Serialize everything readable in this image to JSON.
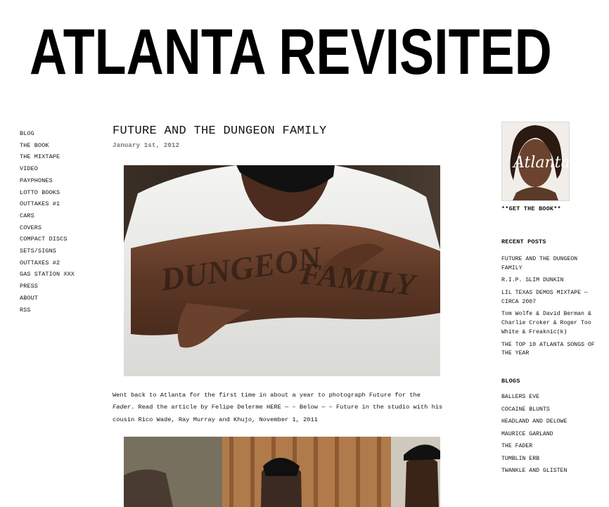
{
  "site": {
    "title": "ATLANTA REVISITED"
  },
  "nav": {
    "items": [
      {
        "label": "BLOG"
      },
      {
        "label": "THE BOOK"
      },
      {
        "label": "THE MIXTAPE"
      },
      {
        "label": "VIDEO"
      },
      {
        "label": "PAYPHONES"
      },
      {
        "label": "LOTTO BOOKS"
      },
      {
        "label": "OUTTAKES #1"
      },
      {
        "label": "CARS"
      },
      {
        "label": "COVERS"
      },
      {
        "label": "COMPACT DISCS"
      },
      {
        "label": "SETS/SIGNS"
      },
      {
        "label": "OUTTAXES #2"
      },
      {
        "label": "GAS STATION XXX"
      },
      {
        "label": "PRESS"
      },
      {
        "label": "ABOUT"
      },
      {
        "label": "RSS"
      }
    ]
  },
  "post": {
    "title": "FUTURE AND THE DUNGEON FAMILY",
    "date": "January 1st, 2012",
    "photo1_tattoo_left": "DUNGEON",
    "photo1_tattoo_right": "FAMILY",
    "body_part1": "Went back to Atlanta for the first time in about a year to photograph Future for the ",
    "body_em": "Fader",
    "body_part2": ". Read the article by Felipe Delerme ",
    "body_link": "HERE",
    "body_part3": " — – Below — – Future in the studio with his cousin Rico Wade, Ray Murray and Khujo, November 1, 2011"
  },
  "sidebar": {
    "cover_script": "Atlanta",
    "get_book": "**GET THE BOOK**",
    "recent_title": "RECENT POSTS",
    "recent_posts": [
      {
        "label": "FUTURE AND THE DUNGEON FAMILY"
      },
      {
        "label": "R.I.P. SLIM DUNKIN"
      },
      {
        "label": "LIL TEXAS DEMOS MIXTAPE — CIRCA 2007"
      },
      {
        "label": "Tom Wolfe & David Berman & Charlie Croker & Roger Too White & Freaknic(k)"
      },
      {
        "label": "THE TOP 10 ATLANTA SONGS OF THE YEAR"
      }
    ],
    "blogs_title": "BLOGS",
    "blogs": [
      {
        "label": "BALLERS EVE"
      },
      {
        "label": "COCAINE BLUNTS"
      },
      {
        "label": "HEADLAND AND DELOWE"
      },
      {
        "label": "MAURICE GARLAND"
      },
      {
        "label": "THE FADER"
      },
      {
        "label": "TUMBLIN ERB"
      },
      {
        "label": "TWANKLE AND GLISTEN"
      }
    ]
  },
  "colors": {
    "text": "#111111",
    "date": "#777777",
    "background": "#ffffff"
  }
}
